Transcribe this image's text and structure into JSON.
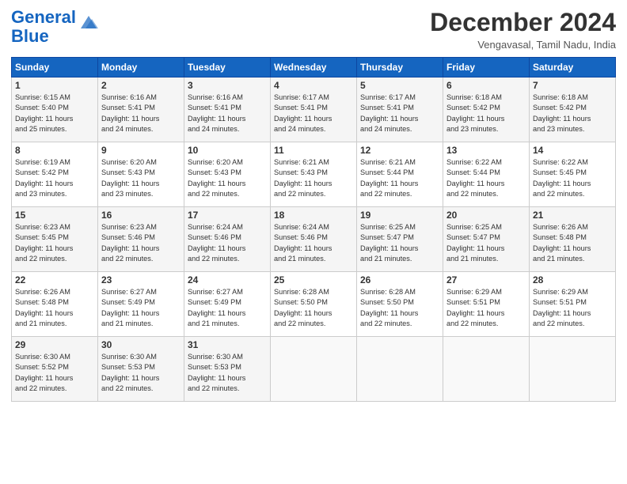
{
  "header": {
    "logo_line1": "General",
    "logo_line2": "Blue",
    "month": "December 2024",
    "location": "Vengavasal, Tamil Nadu, India"
  },
  "days_of_week": [
    "Sunday",
    "Monday",
    "Tuesday",
    "Wednesday",
    "Thursday",
    "Friday",
    "Saturday"
  ],
  "weeks": [
    [
      {
        "day": "1",
        "info": "Sunrise: 6:15 AM\nSunset: 5:40 PM\nDaylight: 11 hours\nand 25 minutes."
      },
      {
        "day": "2",
        "info": "Sunrise: 6:16 AM\nSunset: 5:41 PM\nDaylight: 11 hours\nand 24 minutes."
      },
      {
        "day": "3",
        "info": "Sunrise: 6:16 AM\nSunset: 5:41 PM\nDaylight: 11 hours\nand 24 minutes."
      },
      {
        "day": "4",
        "info": "Sunrise: 6:17 AM\nSunset: 5:41 PM\nDaylight: 11 hours\nand 24 minutes."
      },
      {
        "day": "5",
        "info": "Sunrise: 6:17 AM\nSunset: 5:41 PM\nDaylight: 11 hours\nand 24 minutes."
      },
      {
        "day": "6",
        "info": "Sunrise: 6:18 AM\nSunset: 5:42 PM\nDaylight: 11 hours\nand 23 minutes."
      },
      {
        "day": "7",
        "info": "Sunrise: 6:18 AM\nSunset: 5:42 PM\nDaylight: 11 hours\nand 23 minutes."
      }
    ],
    [
      {
        "day": "8",
        "info": "Sunrise: 6:19 AM\nSunset: 5:42 PM\nDaylight: 11 hours\nand 23 minutes."
      },
      {
        "day": "9",
        "info": "Sunrise: 6:20 AM\nSunset: 5:43 PM\nDaylight: 11 hours\nand 23 minutes."
      },
      {
        "day": "10",
        "info": "Sunrise: 6:20 AM\nSunset: 5:43 PM\nDaylight: 11 hours\nand 22 minutes."
      },
      {
        "day": "11",
        "info": "Sunrise: 6:21 AM\nSunset: 5:43 PM\nDaylight: 11 hours\nand 22 minutes."
      },
      {
        "day": "12",
        "info": "Sunrise: 6:21 AM\nSunset: 5:44 PM\nDaylight: 11 hours\nand 22 minutes."
      },
      {
        "day": "13",
        "info": "Sunrise: 6:22 AM\nSunset: 5:44 PM\nDaylight: 11 hours\nand 22 minutes."
      },
      {
        "day": "14",
        "info": "Sunrise: 6:22 AM\nSunset: 5:45 PM\nDaylight: 11 hours\nand 22 minutes."
      }
    ],
    [
      {
        "day": "15",
        "info": "Sunrise: 6:23 AM\nSunset: 5:45 PM\nDaylight: 11 hours\nand 22 minutes."
      },
      {
        "day": "16",
        "info": "Sunrise: 6:23 AM\nSunset: 5:46 PM\nDaylight: 11 hours\nand 22 minutes."
      },
      {
        "day": "17",
        "info": "Sunrise: 6:24 AM\nSunset: 5:46 PM\nDaylight: 11 hours\nand 22 minutes."
      },
      {
        "day": "18",
        "info": "Sunrise: 6:24 AM\nSunset: 5:46 PM\nDaylight: 11 hours\nand 21 minutes."
      },
      {
        "day": "19",
        "info": "Sunrise: 6:25 AM\nSunset: 5:47 PM\nDaylight: 11 hours\nand 21 minutes."
      },
      {
        "day": "20",
        "info": "Sunrise: 6:25 AM\nSunset: 5:47 PM\nDaylight: 11 hours\nand 21 minutes."
      },
      {
        "day": "21",
        "info": "Sunrise: 6:26 AM\nSunset: 5:48 PM\nDaylight: 11 hours\nand 21 minutes."
      }
    ],
    [
      {
        "day": "22",
        "info": "Sunrise: 6:26 AM\nSunset: 5:48 PM\nDaylight: 11 hours\nand 21 minutes."
      },
      {
        "day": "23",
        "info": "Sunrise: 6:27 AM\nSunset: 5:49 PM\nDaylight: 11 hours\nand 21 minutes."
      },
      {
        "day": "24",
        "info": "Sunrise: 6:27 AM\nSunset: 5:49 PM\nDaylight: 11 hours\nand 21 minutes."
      },
      {
        "day": "25",
        "info": "Sunrise: 6:28 AM\nSunset: 5:50 PM\nDaylight: 11 hours\nand 22 minutes."
      },
      {
        "day": "26",
        "info": "Sunrise: 6:28 AM\nSunset: 5:50 PM\nDaylight: 11 hours\nand 22 minutes."
      },
      {
        "day": "27",
        "info": "Sunrise: 6:29 AM\nSunset: 5:51 PM\nDaylight: 11 hours\nand 22 minutes."
      },
      {
        "day": "28",
        "info": "Sunrise: 6:29 AM\nSunset: 5:51 PM\nDaylight: 11 hours\nand 22 minutes."
      }
    ],
    [
      {
        "day": "29",
        "info": "Sunrise: 6:30 AM\nSunset: 5:52 PM\nDaylight: 11 hours\nand 22 minutes."
      },
      {
        "day": "30",
        "info": "Sunrise: 6:30 AM\nSunset: 5:53 PM\nDaylight: 11 hours\nand 22 minutes."
      },
      {
        "day": "31",
        "info": "Sunrise: 6:30 AM\nSunset: 5:53 PM\nDaylight: 11 hours\nand 22 minutes."
      },
      {
        "day": "",
        "info": ""
      },
      {
        "day": "",
        "info": ""
      },
      {
        "day": "",
        "info": ""
      },
      {
        "day": "",
        "info": ""
      }
    ]
  ]
}
